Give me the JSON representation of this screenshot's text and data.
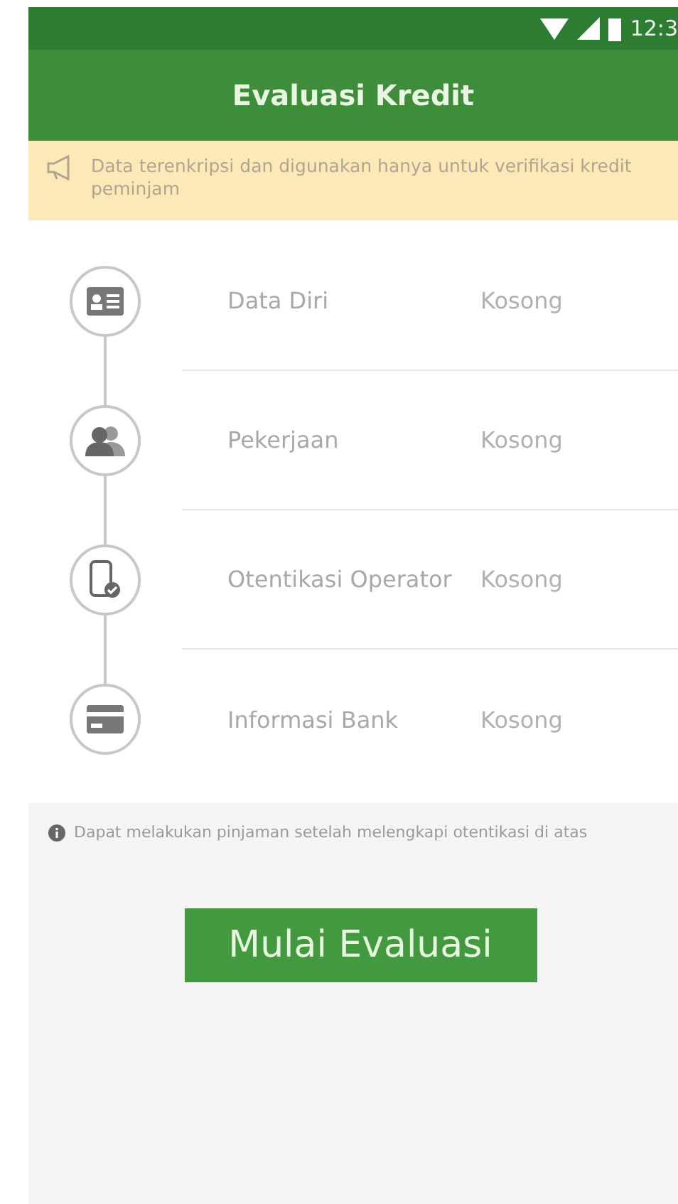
{
  "status_bar": {
    "time": "12:3"
  },
  "app_bar": {
    "title": "Evaluasi Kredit"
  },
  "notice": {
    "text": "Data terenkripsi dan digunakan hanya untuk verifikasi kredit peminjam"
  },
  "steps": [
    {
      "label": "Data Diri",
      "status": "Kosong"
    },
    {
      "label": "Pekerjaan",
      "status": "Kosong"
    },
    {
      "label": "Otentikasi Operator",
      "status": "Kosong"
    },
    {
      "label": "Informasi Bank",
      "status": "Kosong"
    }
  ],
  "hint": {
    "text": "Dapat melakukan pinjaman setelah melengkapi otentikasi di atas"
  },
  "button": {
    "label": "Mulai Evaluasi"
  }
}
